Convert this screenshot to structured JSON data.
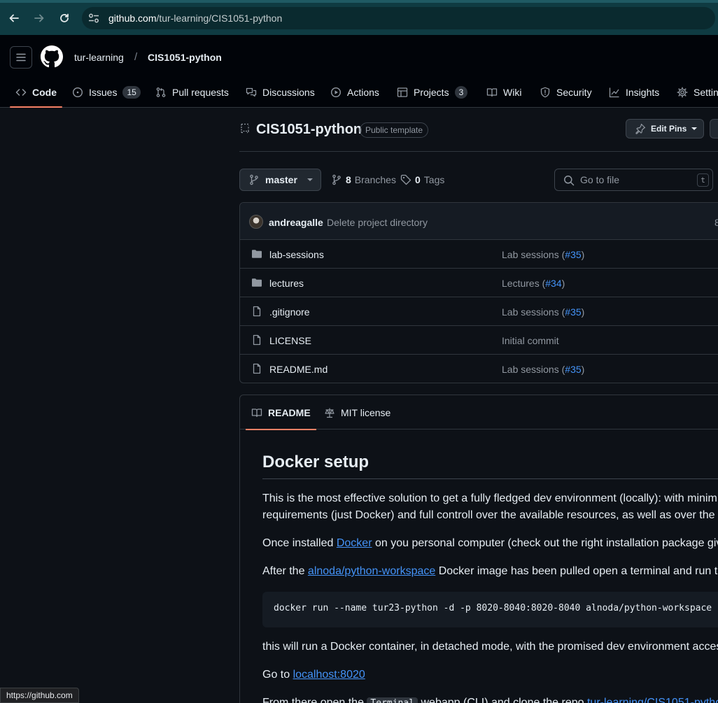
{
  "browser": {
    "url_host": "github.com",
    "url_path": "/tur-learning/CIS1051-python",
    "status_url": "https://github.com"
  },
  "header": {
    "owner": "tur-learning",
    "separator": "/",
    "repo": "CIS1051-python"
  },
  "repo_nav": {
    "tabs": [
      {
        "label": "Code",
        "icon": "code-icon"
      },
      {
        "label": "Issues",
        "icon": "issue-opened-icon",
        "count": "15"
      },
      {
        "label": "Pull requests",
        "icon": "git-pull-request-icon"
      },
      {
        "label": "Discussions",
        "icon": "comment-discussion-icon"
      },
      {
        "label": "Actions",
        "icon": "play-icon"
      },
      {
        "label": "Projects",
        "icon": "table-icon",
        "count": "3"
      },
      {
        "label": "Wiki",
        "icon": "book-icon"
      },
      {
        "label": "Security",
        "icon": "shield-icon"
      },
      {
        "label": "Insights",
        "icon": "graph-icon"
      },
      {
        "label": "Settin",
        "icon": "gear-icon"
      }
    ]
  },
  "repo": {
    "name": "CIS1051-python",
    "visibility_badge": "Public template",
    "edit_pins_label": "Edit Pins"
  },
  "branch_bar": {
    "branch": "master",
    "branches_count": "8",
    "branches_label": "Branches",
    "tags_count": "0",
    "tags_label": "Tags",
    "goto_placeholder": "Go to file",
    "goto_shortcut": "t"
  },
  "latest_commit": {
    "author": "andreagalle",
    "message": "Delete project directory",
    "trailing": "8"
  },
  "files": [
    {
      "name": "lab-sessions",
      "type": "dir",
      "commit_prefix": "Lab sessions (",
      "commit_ref": "#35",
      "commit_suffix": ")"
    },
    {
      "name": "lectures",
      "type": "dir",
      "commit_prefix": "Lectures (",
      "commit_ref": "#34",
      "commit_suffix": ")"
    },
    {
      "name": ".gitignore",
      "type": "file",
      "commit_prefix": "Lab sessions (",
      "commit_ref": "#35",
      "commit_suffix": ")"
    },
    {
      "name": "LICENSE",
      "type": "file",
      "commit_prefix": "Initial commit",
      "commit_ref": "",
      "commit_suffix": ""
    },
    {
      "name": "README.md",
      "type": "file",
      "commit_prefix": "Lab sessions (",
      "commit_ref": "#35",
      "commit_suffix": ")"
    }
  ],
  "readme": {
    "tab_readme": "README",
    "tab_license": "MIT license",
    "heading": "Docker setup",
    "p1_line1": "This is the most effective solution to get a fully fledged dev environment (locally): with minim",
    "p1_line2": "requirements (just Docker) and full controll over the available resources, as well as over the w",
    "p2_before": "Once installed ",
    "p2_link": "Docker",
    "p2_after": " on you personal computer (check out the right installation package giv",
    "p3_before": "After the ",
    "p3_link": "alnoda/python-workspace",
    "p3_after": " Docker image has been pulled open a terminal and run t",
    "code": "docker run --name tur23-python -d -p 8020-8040:8020-8040 alnoda/python-workspace",
    "p4": "this will run a Docker container, in detached mode, with the promised dev environment acces",
    "p5_before": "Go to ",
    "p5_link": "localhost:8020",
    "p6_before": "From there open the ",
    "p6_code": "Terminal",
    "p6_after": " webapp (CLI) and clone the repo ",
    "p6_link": "tur-learning/CIS1051-pytho"
  }
}
